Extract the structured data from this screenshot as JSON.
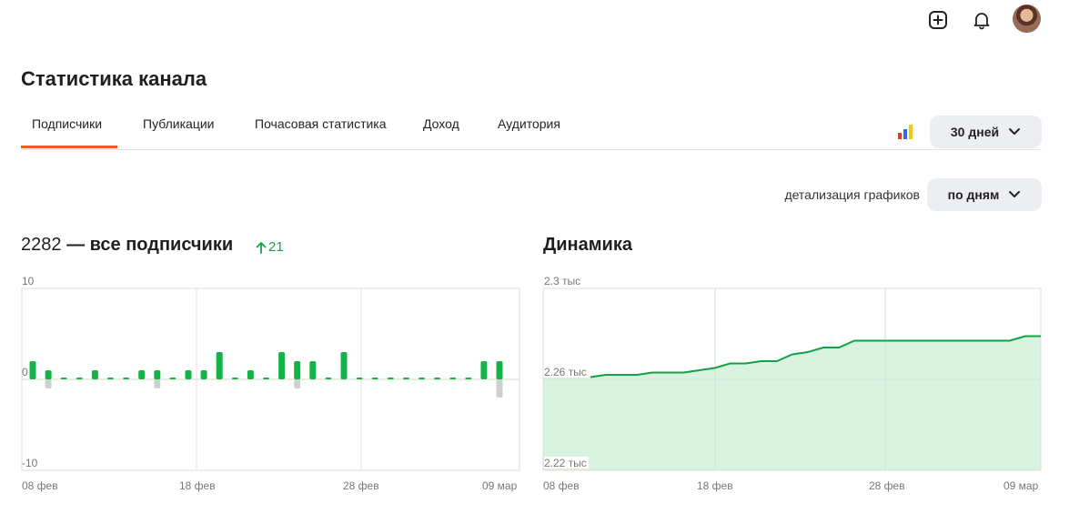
{
  "header": {
    "icons": [
      "add-icon",
      "bell-icon"
    ],
    "avatar": "avatar"
  },
  "page_title": "Статистика канала",
  "tabs": [
    {
      "label": "Подписчики",
      "active": true
    },
    {
      "label": "Публикации",
      "active": false
    },
    {
      "label": "Почасовая статистика",
      "active": false
    },
    {
      "label": "Доход",
      "active": false
    },
    {
      "label": "Аудитория",
      "active": false
    }
  ],
  "controls": {
    "period": "30 дней",
    "detail_label": "детализация графиков",
    "detail_value": "по дням",
    "colors": {
      "accent": "#f25a1d",
      "green": "#16a34a",
      "pill_bg": "#eceef2"
    }
  },
  "subscribers_chart": {
    "count": "2282",
    "title_suffix": "— все подписчики",
    "delta": "21"
  },
  "dynamics_title": "Динамика",
  "chart_data": [
    {
      "type": "bar",
      "ylim": [
        -10,
        10
      ],
      "y_ticks": [
        "10",
        "0",
        "-10"
      ],
      "x_ticks": [
        "08 фев",
        "18 фев",
        "28 фев",
        "09 мар"
      ],
      "series": [
        {
          "values": [
            2,
            1,
            0,
            0,
            1,
            0,
            0,
            1,
            1,
            0,
            1,
            1,
            3,
            0,
            1,
            0,
            3,
            2,
            2,
            0,
            3,
            0,
            0,
            0,
            0,
            0,
            0,
            0,
            0,
            2,
            2
          ]
        },
        {
          "values": [
            0,
            -1,
            0,
            0,
            0,
            0,
            0,
            0,
            -1,
            0,
            0,
            0,
            0,
            0,
            0,
            0,
            0,
            -1,
            0,
            0,
            0,
            0,
            0,
            0,
            0,
            0,
            0,
            0,
            0,
            0,
            -2
          ]
        }
      ]
    },
    {
      "type": "area",
      "ylim": [
        2.22,
        2.3
      ],
      "y_ticks": [
        "2.3 тыс",
        "2.26 тыс",
        "2.22 тыс"
      ],
      "x_ticks": [
        "08 фев",
        "18 фев",
        "28 фев",
        "09 мар"
      ],
      "series": [
        {
          "values": [
            2261,
            2262,
            2262,
            2262,
            2263,
            2263,
            2263,
            2264,
            2265,
            2267,
            2267,
            2268,
            2268,
            2271,
            2272,
            2274,
            2274,
            2277,
            2277,
            2277,
            2277,
            2277,
            2277,
            2277,
            2277,
            2277,
            2277,
            2277,
            2279,
            2279
          ]
        }
      ]
    }
  ]
}
